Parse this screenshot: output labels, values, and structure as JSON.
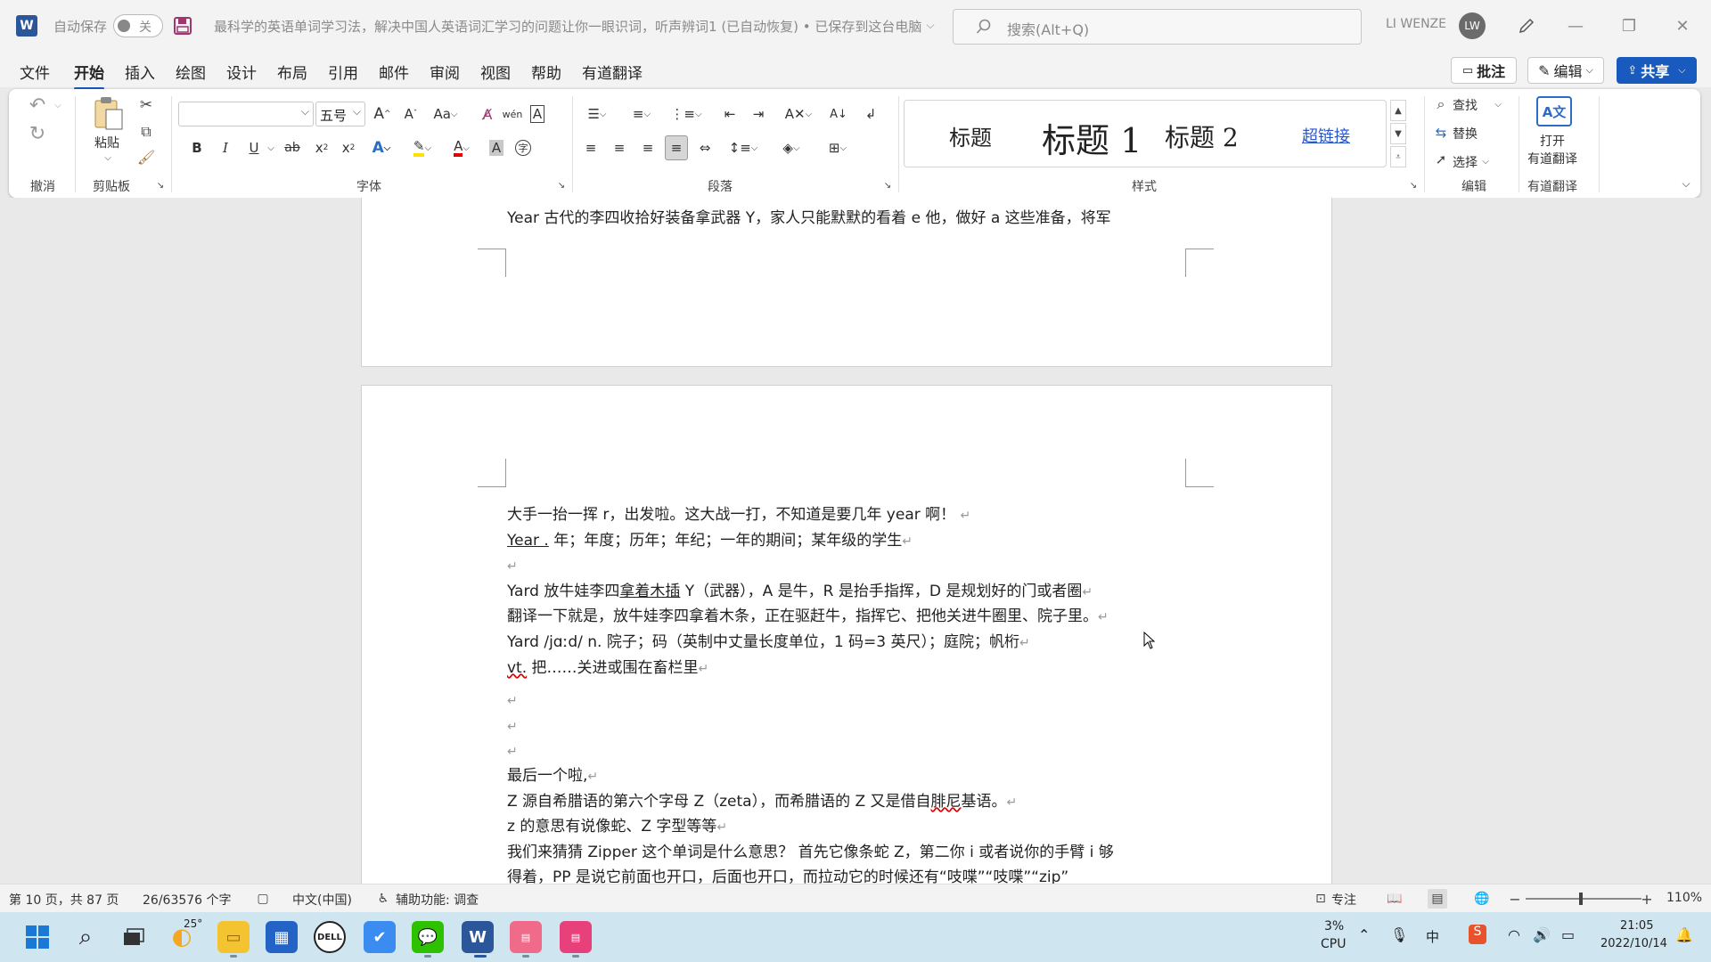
{
  "titlebar": {
    "autosave_label": "自动保存",
    "autosave_state": "关",
    "doc_title": "最科学的英语单词学习法，解决中国人英语词汇学习的问题让你一眼识词，听声辨词1 (已自动恢复) • 已保存到这台电脑",
    "search_placeholder": "搜索(Alt+Q)",
    "user_name": "LI WENZE",
    "avatar_initials": "LW"
  },
  "menu": {
    "items": [
      "文件",
      "开始",
      "插入",
      "绘图",
      "设计",
      "布局",
      "引用",
      "邮件",
      "审阅",
      "视图",
      "帮助",
      "有道翻译"
    ],
    "active": "开始",
    "comments_label": "批注",
    "editing_label": "编辑",
    "share_label": "共享"
  },
  "ribbon": {
    "groups": {
      "undo": "撤消",
      "clipboard": "剪贴板",
      "font": "字体",
      "paragraph": "段落",
      "styles": "样式",
      "editing": "编辑",
      "youdao": "有道翻译"
    },
    "paste_label": "粘贴",
    "font_name": "",
    "font_size": "五号",
    "styles": [
      "标题",
      "标题 1",
      "标题 2",
      "超链接"
    ],
    "find_label": "查找",
    "replace_label": "替换",
    "select_label": "选择",
    "youdao_btn_line1": "打开",
    "youdao_btn_line2": "有道翻译"
  },
  "document": {
    "page1_last_line": "Year  古代的李四收拾好装备拿武器 Y，家人只能默默的看着 e 他，做好 a 这些准备，将军",
    "lines": [
      {
        "pre": "大手一抬一挥 r，出发啦。这大战一打，不知道是要几年 year 啊！",
        "mark": "↵"
      },
      {
        "u": "Year .",
        "pre": " 年；年度；历年；年纪；一年的期间；某年级的学生",
        "mark": "↵"
      },
      {
        "pre": "",
        "mark": "↵"
      },
      {
        "pre": "Yard 放牛娃李四",
        "u": "拿着木插",
        "post": " Y（武器），A 是牛，R 是抬手指挥，D 是规划好的门或者圈",
        "mark": "↵"
      },
      {
        "pre": "翻译一下就是，放牛娃李四拿着木条，正在驱赶牛，指挥它、把他关进牛圈里、院子里。",
        "mark": "↵"
      },
      {
        "pre": "Yard /jɑːd/ n. 院子；码（英制中丈量长度单位，1 码=3 英尺）；庭院；帆桁",
        "mark": "↵"
      },
      {
        "w": "vt.",
        "pre": " 把……关进或围在畜栏里",
        "mark": "↵"
      },
      {
        "pre": "",
        "mark": "↵"
      },
      {
        "pre": "",
        "mark": "↵"
      },
      {
        "pre": "",
        "mark": "↵"
      },
      {
        "pre": "最后一个啦,",
        "mark": "↵"
      },
      {
        "pre": "Z 源自希腊语的第六个字母 Z（zeta），而希腊语的 Z 又是借自",
        "w": "腓尼",
        "post": "基语。",
        "mark": "↵"
      },
      {
        "pre": "z 的意思有说像蛇、Z 字型等等",
        "mark": "↵"
      },
      {
        "pre": "我们来猜猜 Zipper  这个单词是什么意思？  首先它像条蛇 Z，第二你 i 或者说你的手臂 i 够",
        "mark": ""
      },
      {
        "pre": "得着，PP 是说它前面也开口，后面也开口，而拉动它的时候还有“吱喋”“吱喋”“zip”",
        "mark": ""
      }
    ]
  },
  "status": {
    "page": "第 10 页，共 87 页",
    "words": "26/63576 个字",
    "language": "中文(中国)",
    "accessibility": "辅助功能: 调查",
    "focus": "专注",
    "zoom": "110%"
  },
  "taskbar": {
    "weather_temp": "25°",
    "cpu_percent": "3%",
    "cpu_label": "CPU",
    "ime": "中",
    "time": "21:05",
    "date": "2022/10/14"
  },
  "colors": {
    "accent": "#185abd",
    "word_blue": "#2b579a",
    "taskbar": "#cfe6f1",
    "hyperlink": "#2b56c9"
  }
}
